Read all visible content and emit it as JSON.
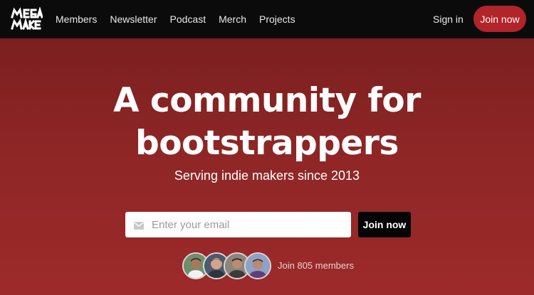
{
  "nav": {
    "logo_alt": "MEGA MAKER",
    "links": [
      "Members",
      "Newsletter",
      "Podcast",
      "Merch",
      "Projects"
    ],
    "sign_in": "Sign in",
    "join": "Join now"
  },
  "hero": {
    "title_line1": "A community for",
    "title_line2": "bootstrappers",
    "subtitle": "Serving indie makers since 2013",
    "email_placeholder": "Enter your email",
    "join": "Join now",
    "member_count_text": "Join 805 members"
  },
  "icons": {
    "logo": "mega-maker-logo",
    "email": "mail-icon",
    "avatars": [
      "avatar-1",
      "avatar-2",
      "avatar-3",
      "avatar-4"
    ]
  },
  "colors": {
    "nav_bg": "#0b0b0b",
    "hero_bg": "#8f2626",
    "accent": "#b3232a",
    "hero_button": "#050505"
  }
}
